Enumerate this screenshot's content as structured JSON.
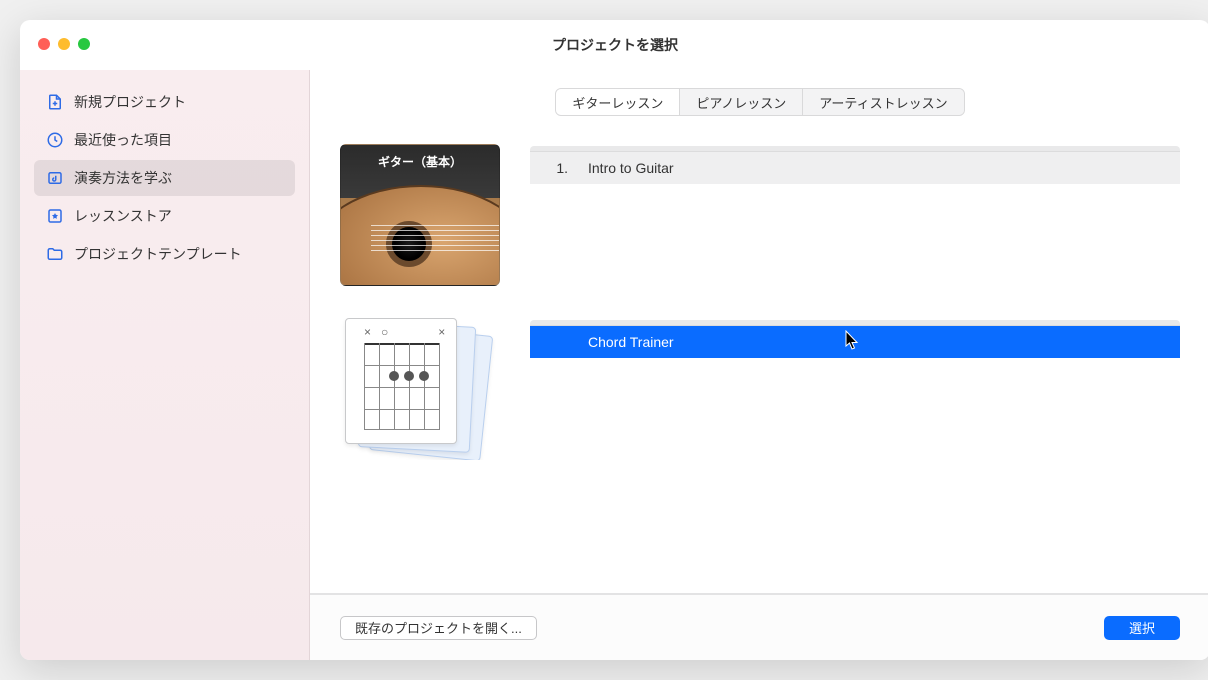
{
  "window_title": "プロジェクトを選択",
  "sidebar": {
    "items": [
      {
        "label": "新規プロジェクト",
        "icon": "document-plus-icon",
        "selected": false
      },
      {
        "label": "最近使った項目",
        "icon": "clock-icon",
        "selected": false
      },
      {
        "label": "演奏方法を学ぶ",
        "icon": "music-note-icon",
        "selected": true
      },
      {
        "label": "レッスンストア",
        "icon": "star-box-icon",
        "selected": false
      },
      {
        "label": "プロジェクトテンプレート",
        "icon": "folder-icon",
        "selected": false
      }
    ]
  },
  "tabs": {
    "items": [
      {
        "label": "ギターレッスン",
        "selected": true
      },
      {
        "label": "ピアノレッスン",
        "selected": false
      },
      {
        "label": "アーティストレッスン",
        "selected": false
      }
    ]
  },
  "groups": [
    {
      "thumb_title": "ギター（基本）",
      "thumb_kind": "guitar",
      "rows": [
        {
          "num": "1.",
          "title": "Intro to Guitar",
          "selected": false
        }
      ]
    },
    {
      "thumb_title": "",
      "thumb_kind": "chord",
      "rows": [
        {
          "num": "",
          "title": "Chord Trainer",
          "selected": true
        }
      ]
    }
  ],
  "footer": {
    "open_existing": "既存のプロジェクトを開く...",
    "choose": "選択"
  }
}
